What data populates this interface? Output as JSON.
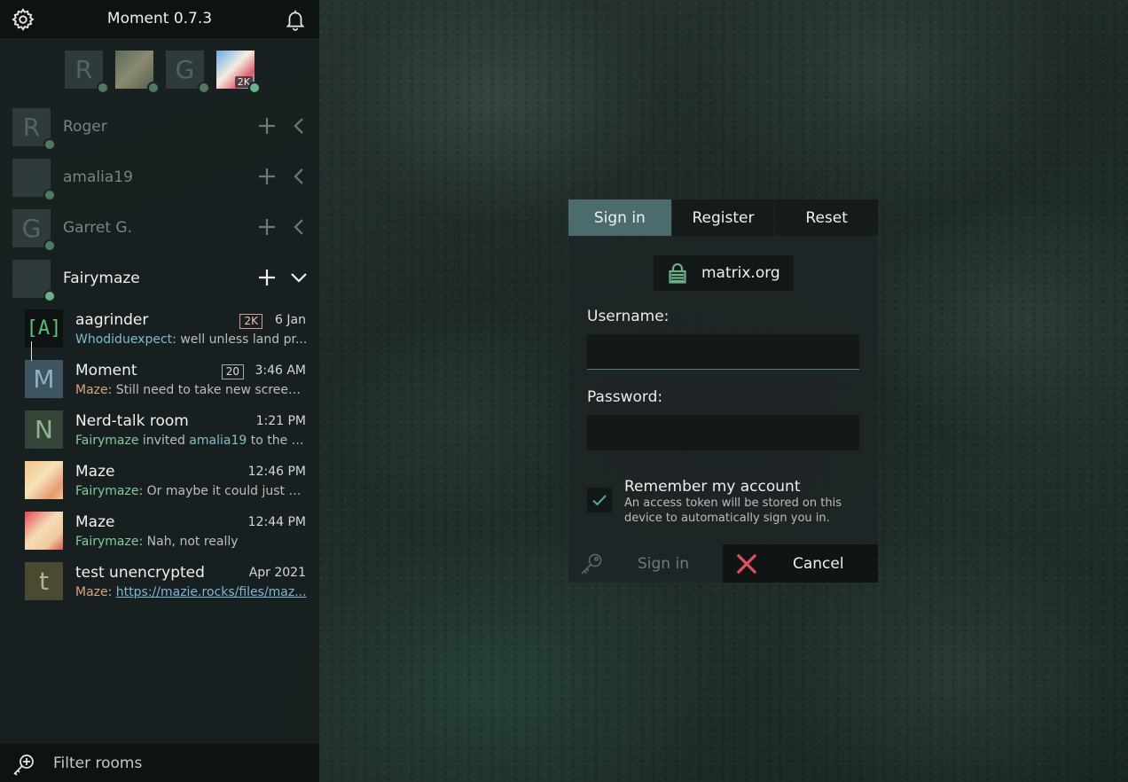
{
  "app": {
    "title": "Moment 0.7.3"
  },
  "accounts_bar": [
    {
      "initial": "R",
      "kind": "letter"
    },
    {
      "initial": "",
      "kind": "photo-cat"
    },
    {
      "initial": "G",
      "kind": "letter"
    },
    {
      "initial": "",
      "kind": "photo-fairy",
      "badge": "2K"
    }
  ],
  "accounts": [
    {
      "initial": "R",
      "name": "Roger"
    },
    {
      "initial": "",
      "name": "amalia19"
    },
    {
      "initial": "G",
      "name": "Garret G."
    },
    {
      "initial": "",
      "name": "Fairymaze"
    }
  ],
  "rooms": [
    {
      "initial": "[A]",
      "name": "aagrinder",
      "count": "2K",
      "time": "6 Jan",
      "sender": "Whodiduexpect",
      "message": ": well unless land pr..."
    },
    {
      "initial": "M",
      "name": "Moment",
      "count": "20",
      "time": "3:46 AM",
      "sender": "Maze",
      "message": ": Still need to take new screens..."
    },
    {
      "initial": "N",
      "name": "Nerd-talk room",
      "count": "",
      "time": "1:21 PM",
      "sender": "Fairymaze",
      "message_mid": " invited ",
      "sender2": "amalia19",
      "message": " to the ro..."
    },
    {
      "initial": "",
      "name": "Maze",
      "count": "",
      "time": "12:46 PM",
      "sender": "Fairymaze",
      "message": ": Or maybe it could just be..."
    },
    {
      "initial": "",
      "name": "Maze",
      "count": "",
      "time": "12:44 PM",
      "sender": "Fairymaze",
      "message": ": Nah, not really"
    },
    {
      "initial": "t",
      "name": "test unencrypted",
      "count": "",
      "time": "Apr 2021",
      "sender": "Maze",
      "message": ": ",
      "link": "https://mazie.rocks/files/maz..."
    }
  ],
  "filter": {
    "placeholder": "Filter rooms"
  },
  "login": {
    "tabs": [
      "Sign in",
      "Register",
      "Reset"
    ],
    "active_tab": "Sign in",
    "server": "matrix.org",
    "username_label": "Username:",
    "username_value": "",
    "password_label": "Password:",
    "password_value": "",
    "remember_title": "Remember my account",
    "remember_desc": "An access token will be stored on this device to automatically sign you in.",
    "remember_checked": true,
    "signin_label": "Sign in",
    "cancel_label": "Cancel"
  },
  "colors": {
    "accent": "#4c6b6c",
    "presence": "#6bb089",
    "cancel": "#e0505c"
  }
}
